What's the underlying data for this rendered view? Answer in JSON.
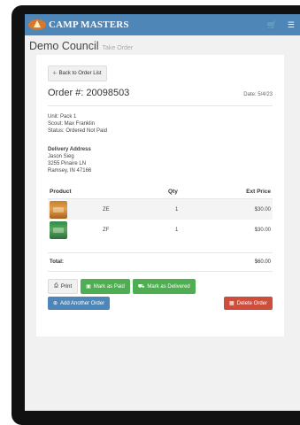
{
  "app": {
    "brand": "CAMP MASTERS",
    "cart_icon": "cart-icon",
    "menu_icon": "menu-icon"
  },
  "header": {
    "title": "Demo Council",
    "subtitle": "Take Order"
  },
  "order": {
    "back_label": "Back to Order List",
    "number_label": "Order #:",
    "number": "20098503",
    "date": "Date: 5/4/23",
    "unit": "Unit: Pack 1",
    "scout": "Scout: Max Franklin",
    "status": "Status: Ordered Not Paid"
  },
  "delivery": {
    "title": "Delivery Address",
    "name": "Jason Sieg",
    "street": "3255 Pinaire LN",
    "city": "Ramsey, IN 47166"
  },
  "table": {
    "headers": {
      "product": "Product",
      "qty": "Qty",
      "ext": "Ext Price"
    },
    "rows": [
      {
        "code": "ZE",
        "qty": "1",
        "ext": "$30.00"
      },
      {
        "code": "ZF",
        "qty": "1",
        "ext": "$30.00"
      }
    ],
    "total_label": "Total:",
    "total_value": "$60.00"
  },
  "actions": {
    "print": "Print",
    "mark_paid": "Mark as Paid",
    "mark_delivered": "Mark as Delivered",
    "add_another": "Add Another Order",
    "delete": "Delete Order"
  },
  "colors": {
    "header_blue": "#4f86b8",
    "green": "#4fae52",
    "red": "#cf4d3b"
  }
}
